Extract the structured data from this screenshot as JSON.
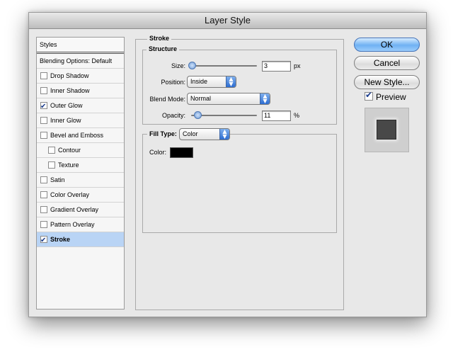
{
  "window": {
    "title": "Layer Style"
  },
  "styles_panel": {
    "header": "Styles",
    "blending": "Blending Options: Default",
    "items": [
      {
        "label": "Drop Shadow",
        "checked": false
      },
      {
        "label": "Inner Shadow",
        "checked": false
      },
      {
        "label": "Outer Glow",
        "checked": true
      },
      {
        "label": "Inner Glow",
        "checked": false
      },
      {
        "label": "Bevel and Emboss",
        "checked": false
      },
      {
        "label": "Contour",
        "checked": false
      },
      {
        "label": "Texture",
        "checked": false
      },
      {
        "label": "Satin",
        "checked": false
      },
      {
        "label": "Color Overlay",
        "checked": false
      },
      {
        "label": "Gradient Overlay",
        "checked": false
      },
      {
        "label": "Pattern Overlay",
        "checked": false
      },
      {
        "label": "Stroke",
        "checked": true,
        "selected": true
      }
    ]
  },
  "stroke": {
    "title": "Stroke",
    "structure": {
      "title": "Structure",
      "size_label": "Size:",
      "size_value": "3",
      "size_unit": "px",
      "position_label": "Position:",
      "position_value": "Inside",
      "blend_mode_label": "Blend Mode:",
      "blend_mode_value": "Normal",
      "opacity_label": "Opacity:",
      "opacity_value": "11",
      "opacity_unit": "%"
    },
    "fill": {
      "fill_type_label": "Fill Type:",
      "fill_type_value": "Color",
      "color_label": "Color:",
      "color_value": "#000000"
    }
  },
  "buttons": {
    "ok": "OK",
    "cancel": "Cancel",
    "new_style": "New Style..."
  },
  "preview": {
    "label": "Preview",
    "checked": true
  }
}
